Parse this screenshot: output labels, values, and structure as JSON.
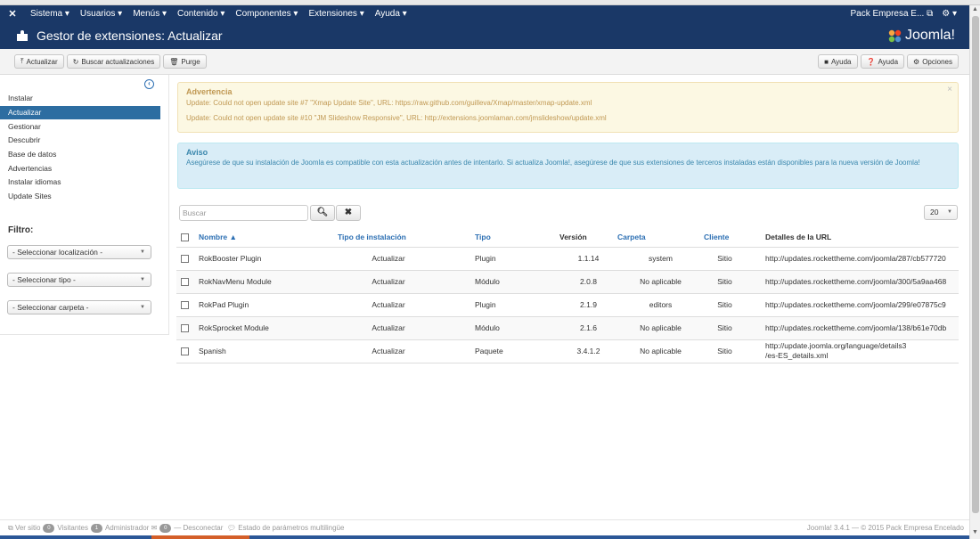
{
  "navbar": {
    "menu": [
      "Sistema ▾",
      "Usuarios ▾",
      "Menús ▾",
      "Contenido ▾",
      "Componentes ▾",
      "Extensiones ▾",
      "Ayuda ▾"
    ],
    "site_name": "Pack Empresa E...",
    "settings": "⚙ ▾"
  },
  "header": {
    "title": "Gestor de extensiones: Actualizar",
    "brand": "Joomla!"
  },
  "toolbar": {
    "update": "Actualizar",
    "find_updates": "Buscar actualizaciones",
    "purge": "Purge",
    "help_video": "Ayuda",
    "help": "Ayuda",
    "options": "Opciones"
  },
  "sidebar": {
    "items": [
      "Instalar",
      "Actualizar",
      "Gestionar",
      "Descubrir",
      "Base de datos",
      "Advertencias",
      "Instalar idiomas",
      "Update Sites"
    ],
    "filter_title": "Filtro:",
    "selects": [
      "- Seleccionar localización -",
      "- Seleccionar tipo -",
      "- Seleccionar carpeta -"
    ]
  },
  "warning": {
    "title": "Advertencia",
    "lines": [
      "Update: Could not open update site #7 \"Xmap Update Site\", URL: https://raw.github.com/guilleva/Xmap/master/xmap-update.xml",
      "Update: Could not open update site #10 \"JM Slideshow Responsive\", URL: http://extensions.joomlaman.com/jmslideshow/update.xml"
    ]
  },
  "info": {
    "title": "Aviso",
    "text": "Asegúrese de que su instalación de Joomla es compatible con esta actualización antes de intentarlo. Si actualiza Joomla!, asegúrese de que sus extensiones de terceros instaladas están disponibles para la nueva versión de Joomla!"
  },
  "search": {
    "placeholder": "Buscar"
  },
  "limit": "20",
  "table": {
    "headers": [
      "Nombre ▲",
      "Tipo de instalación",
      "Tipo",
      "Versión",
      "Carpeta",
      "Cliente",
      "Detalles de la URL"
    ],
    "rows": [
      [
        "RokBooster Plugin",
        "Actualizar",
        "Plugin",
        "1.1.14",
        "system",
        "Sitio",
        "http://updates.rockettheme.com/joomla/287/cb577720"
      ],
      [
        "RokNavMenu Module",
        "Actualizar",
        "Módulo",
        "2.0.8",
        "No aplicable",
        "Sitio",
        "http://updates.rockettheme.com/joomla/300/5a9aa468"
      ],
      [
        "RokPad Plugin",
        "Actualizar",
        "Plugin",
        "2.1.9",
        "editors",
        "Sitio",
        "http://updates.rockettheme.com/joomla/299/e07875c9"
      ],
      [
        "RokSprocket Module",
        "Actualizar",
        "Módulo",
        "2.1.6",
        "No aplicable",
        "Sitio",
        "http://updates.rockettheme.com/joomla/138/b61e70db"
      ],
      [
        "Spanish",
        "Actualizar",
        "Paquete",
        "3.4.1.2",
        "No aplicable",
        "Sitio",
        "http://update.joomla.org/language/details3\n/es-ES_details.xml"
      ]
    ]
  },
  "footer": {
    "view_site": "Ver sitio",
    "visitors_count": "0",
    "visitors": "Visitantes",
    "admins_count": "1",
    "admins": "Administrador",
    "messages_count": "0",
    "logout": "Desconectar",
    "multilang": "Estado de parámetros multilingüe",
    "copyright": "Joomla! 3.4.1 — © 2015 Pack Empresa Encelado"
  },
  "colors": {
    "navy": "#1a3867",
    "active": "#2d6da1",
    "link": "#2c6fb3"
  }
}
